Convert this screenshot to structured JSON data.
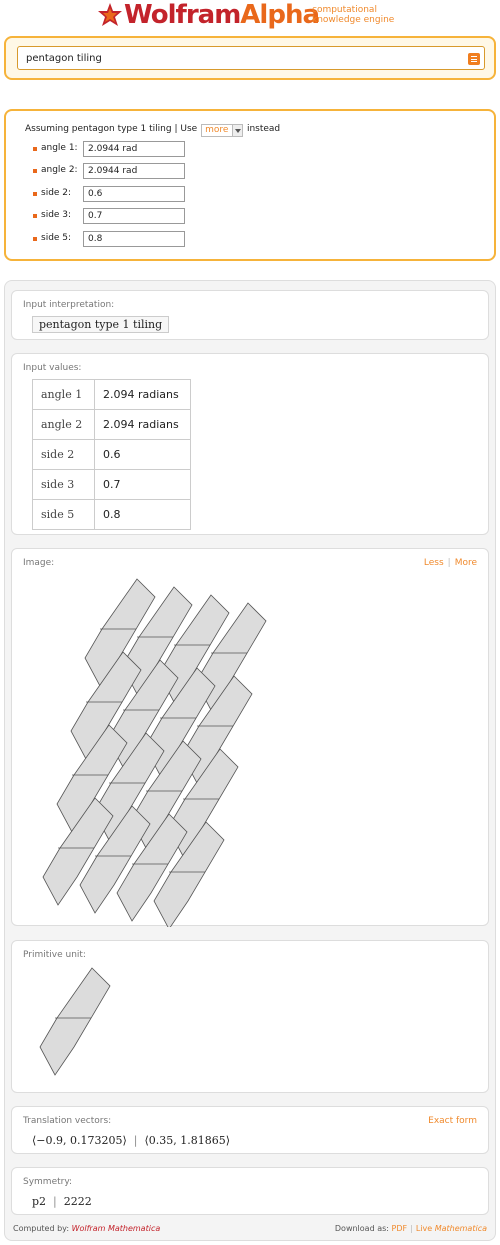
{
  "header": {
    "logo_wolfram": "Wolfram",
    "logo_alpha": "Alpha",
    "tagline_line1": "computational",
    "tagline_line2": "knowledge engine"
  },
  "search": {
    "query": "pentagon tiling"
  },
  "assumption": {
    "prefix": "Assuming pentagon type 1 tiling",
    "separator": "|",
    "use_label": "Use",
    "select_value": "more",
    "suffix": "instead",
    "params": [
      {
        "label": "angle 1:",
        "value": "2.0944 rad"
      },
      {
        "label": "angle 2:",
        "value": "2.0944 rad"
      },
      {
        "label": "side 2:",
        "value": "0.6"
      },
      {
        "label": "side 3:",
        "value": "0.7"
      },
      {
        "label": "side 5:",
        "value": "0.8"
      }
    ]
  },
  "pods": {
    "interpretation": {
      "title": "Input interpretation:",
      "value": "pentagon type 1 tiling"
    },
    "values": {
      "title": "Input values:",
      "rows": [
        {
          "label": "angle 1",
          "value": "2.094 radians"
        },
        {
          "label": "angle 2",
          "value": "2.094 radians"
        },
        {
          "label": "side 2",
          "value": "0.6"
        },
        {
          "label": "side 3",
          "value": "0.7"
        },
        {
          "label": "side 5",
          "value": "0.8"
        }
      ]
    },
    "image": {
      "title": "Image:",
      "less": "Less",
      "more": "More",
      "separator": "|"
    },
    "primitive": {
      "title": "Primitive unit:"
    },
    "translation": {
      "title": "Translation vectors:",
      "exact": "Exact form",
      "vector1": "⟨−0.9, 0.173205⟩",
      "vector2": "⟨0.35, 1.81865⟩",
      "separator": "|"
    },
    "symmetry": {
      "title": "Symmetry:",
      "group": "p2",
      "notation": "2222",
      "separator": "|"
    }
  },
  "footer": {
    "computed_by": "Computed by:",
    "brand_wolfram": "Wolfram",
    "brand_mathematica": "Mathematica",
    "download_as": "Download as:",
    "pdf": "PDF",
    "live": "Live",
    "live_mathematica": "Mathematica",
    "separator": "|"
  },
  "colors": {
    "accent": "#f08a2d",
    "brand_red": "#c3232b",
    "frame": "#f6b33a",
    "tile_fill": "#dcdcdc",
    "tile_stroke": "#555555"
  }
}
